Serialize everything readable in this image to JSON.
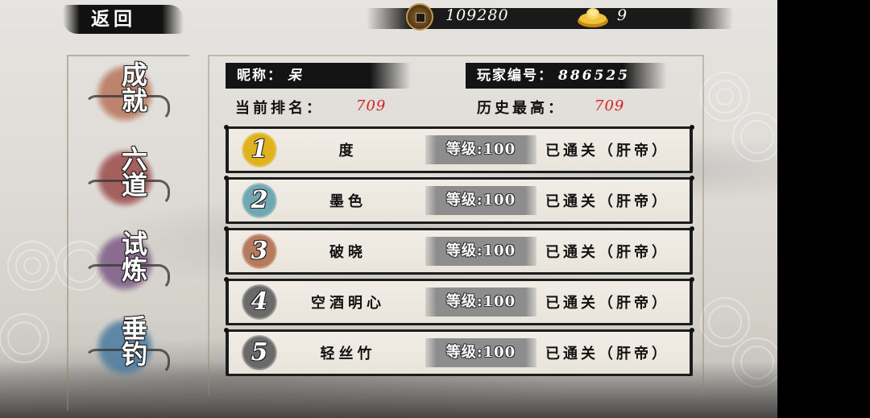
{
  "topbar": {
    "back_label": "返回",
    "coins": "109280",
    "ingots": "9",
    "coin_icon": "copper-coin-icon",
    "ingot_icon": "gold-ingot-icon"
  },
  "menu": [
    {
      "label": "成就",
      "color": "#b7745a"
    },
    {
      "label": "六道",
      "color": "#9a4a4a"
    },
    {
      "label": "试炼",
      "color": "#7c5a86"
    },
    {
      "label": "垂钓",
      "color": "#4a7ca0"
    }
  ],
  "player": {
    "nickname_label": "昵称：",
    "nickname": "呆",
    "id_label": "玩家编号：",
    "id": "886525",
    "current_rank_label": "当前排名：",
    "current_rank": "709",
    "best_rank_label": "历史最高：",
    "best_rank": "709"
  },
  "leaderboard": [
    {
      "rank": "1",
      "name": "度",
      "level": "等级:100",
      "status": "已通关（肝帝）",
      "badge_color": "#e0b21c"
    },
    {
      "rank": "2",
      "name": "墨色",
      "level": "等级:100",
      "status": "已通关（肝帝）",
      "badge_color": "#6fa7b3"
    },
    {
      "rank": "3",
      "name": "破晓",
      "level": "等级:100",
      "status": "已通关（肝帝）",
      "badge_color": "#b77a5c"
    },
    {
      "rank": "4",
      "name": "空酒明心",
      "level": "等级:100",
      "status": "已通关（肝帝）",
      "badge_color": "#6a6a6a"
    },
    {
      "rank": "5",
      "name": "轻丝竹",
      "level": "等级:100",
      "status": "已通关（肝帝）",
      "badge_color": "#6a6a6a"
    }
  ],
  "colors": {
    "rank_highlight": "#d42020",
    "ink": "#141414"
  }
}
